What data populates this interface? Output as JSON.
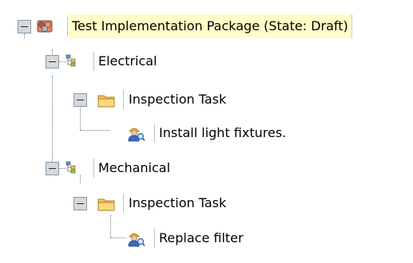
{
  "tree": {
    "root": {
      "label": "Test Implementation Package (State: Draft)",
      "icon": "package-icon",
      "expanded": true
    },
    "groups": [
      {
        "label": "Electrical",
        "icon": "group-tree-icon",
        "expanded": true,
        "children": [
          {
            "label": "Inspection Task",
            "icon": "folder-icon",
            "expanded": true,
            "children": [
              {
                "label": "Install light fixtures.",
                "icon": "worker-inspect-icon"
              }
            ]
          }
        ]
      },
      {
        "label": "Mechanical",
        "icon": "group-tree-icon",
        "expanded": true,
        "children": [
          {
            "label": "Inspection Task",
            "icon": "folder-icon",
            "expanded": true,
            "children": [
              {
                "label": "Replace filter",
                "icon": "worker-inspect-icon"
              }
            ]
          }
        ]
      }
    ]
  },
  "colors": {
    "selected_background": "#fffcc8",
    "toggle_border": "#7f9db9",
    "folder": "#f3c35a"
  }
}
